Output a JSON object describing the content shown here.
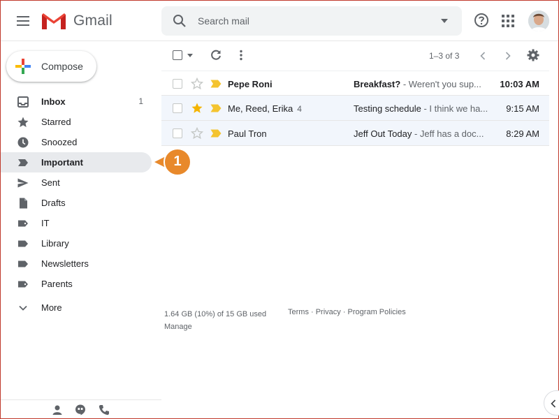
{
  "app": {
    "name": "Gmail"
  },
  "search": {
    "placeholder": "Search mail"
  },
  "compose": {
    "label": "Compose"
  },
  "sidebar": {
    "items": [
      {
        "label": "Inbox",
        "count": "1",
        "icon": "inbox-icon",
        "bold": true
      },
      {
        "label": "Starred",
        "count": "",
        "icon": "star-icon"
      },
      {
        "label": "Snoozed",
        "count": "",
        "icon": "clock-icon"
      },
      {
        "label": "Important",
        "count": "",
        "icon": "important-icon",
        "active": true,
        "bold": true
      },
      {
        "label": "Sent",
        "count": "",
        "icon": "send-icon"
      },
      {
        "label": "Drafts",
        "count": "",
        "icon": "draft-icon"
      },
      {
        "label": "IT",
        "count": "",
        "icon": "label-icon"
      },
      {
        "label": "Library",
        "count": "",
        "icon": "label-icon"
      },
      {
        "label": "Newsletters",
        "count": "",
        "icon": "label-icon"
      },
      {
        "label": "Parents",
        "count": "",
        "icon": "label-icon"
      },
      {
        "label": "More",
        "count": "",
        "icon": "chevron-down-icon"
      }
    ]
  },
  "callout": {
    "number": "1"
  },
  "toolbar": {
    "pager": "1–3 of 3"
  },
  "emails": [
    {
      "sender": "Pepe Roni",
      "count": "",
      "subject": "Breakfast?",
      "snippet": " - Weren't you sup...",
      "time": "10:03 AM",
      "starred": false,
      "unread": true
    },
    {
      "sender": "Me, Reed, Erika",
      "count": "4",
      "subject": "Testing schedule",
      "snippet": " - I think we ha...",
      "time": "9:15 AM",
      "starred": true,
      "unread": false
    },
    {
      "sender": "Paul Tron",
      "count": "",
      "subject": "Jeff Out Today",
      "snippet": "  - Jeff has a doc...",
      "time": "8:29 AM",
      "starred": false,
      "unread": false
    }
  ],
  "footer": {
    "storage": "1.64 GB (10%) of 15 GB used",
    "manage": "Manage",
    "links": "Terms · Privacy · Program Policies"
  },
  "colors": {
    "gmail_red": "#ea4335",
    "important_yellow": "#f4c430",
    "star_yellow": "#f4b400",
    "callout_orange": "#e8892b"
  }
}
